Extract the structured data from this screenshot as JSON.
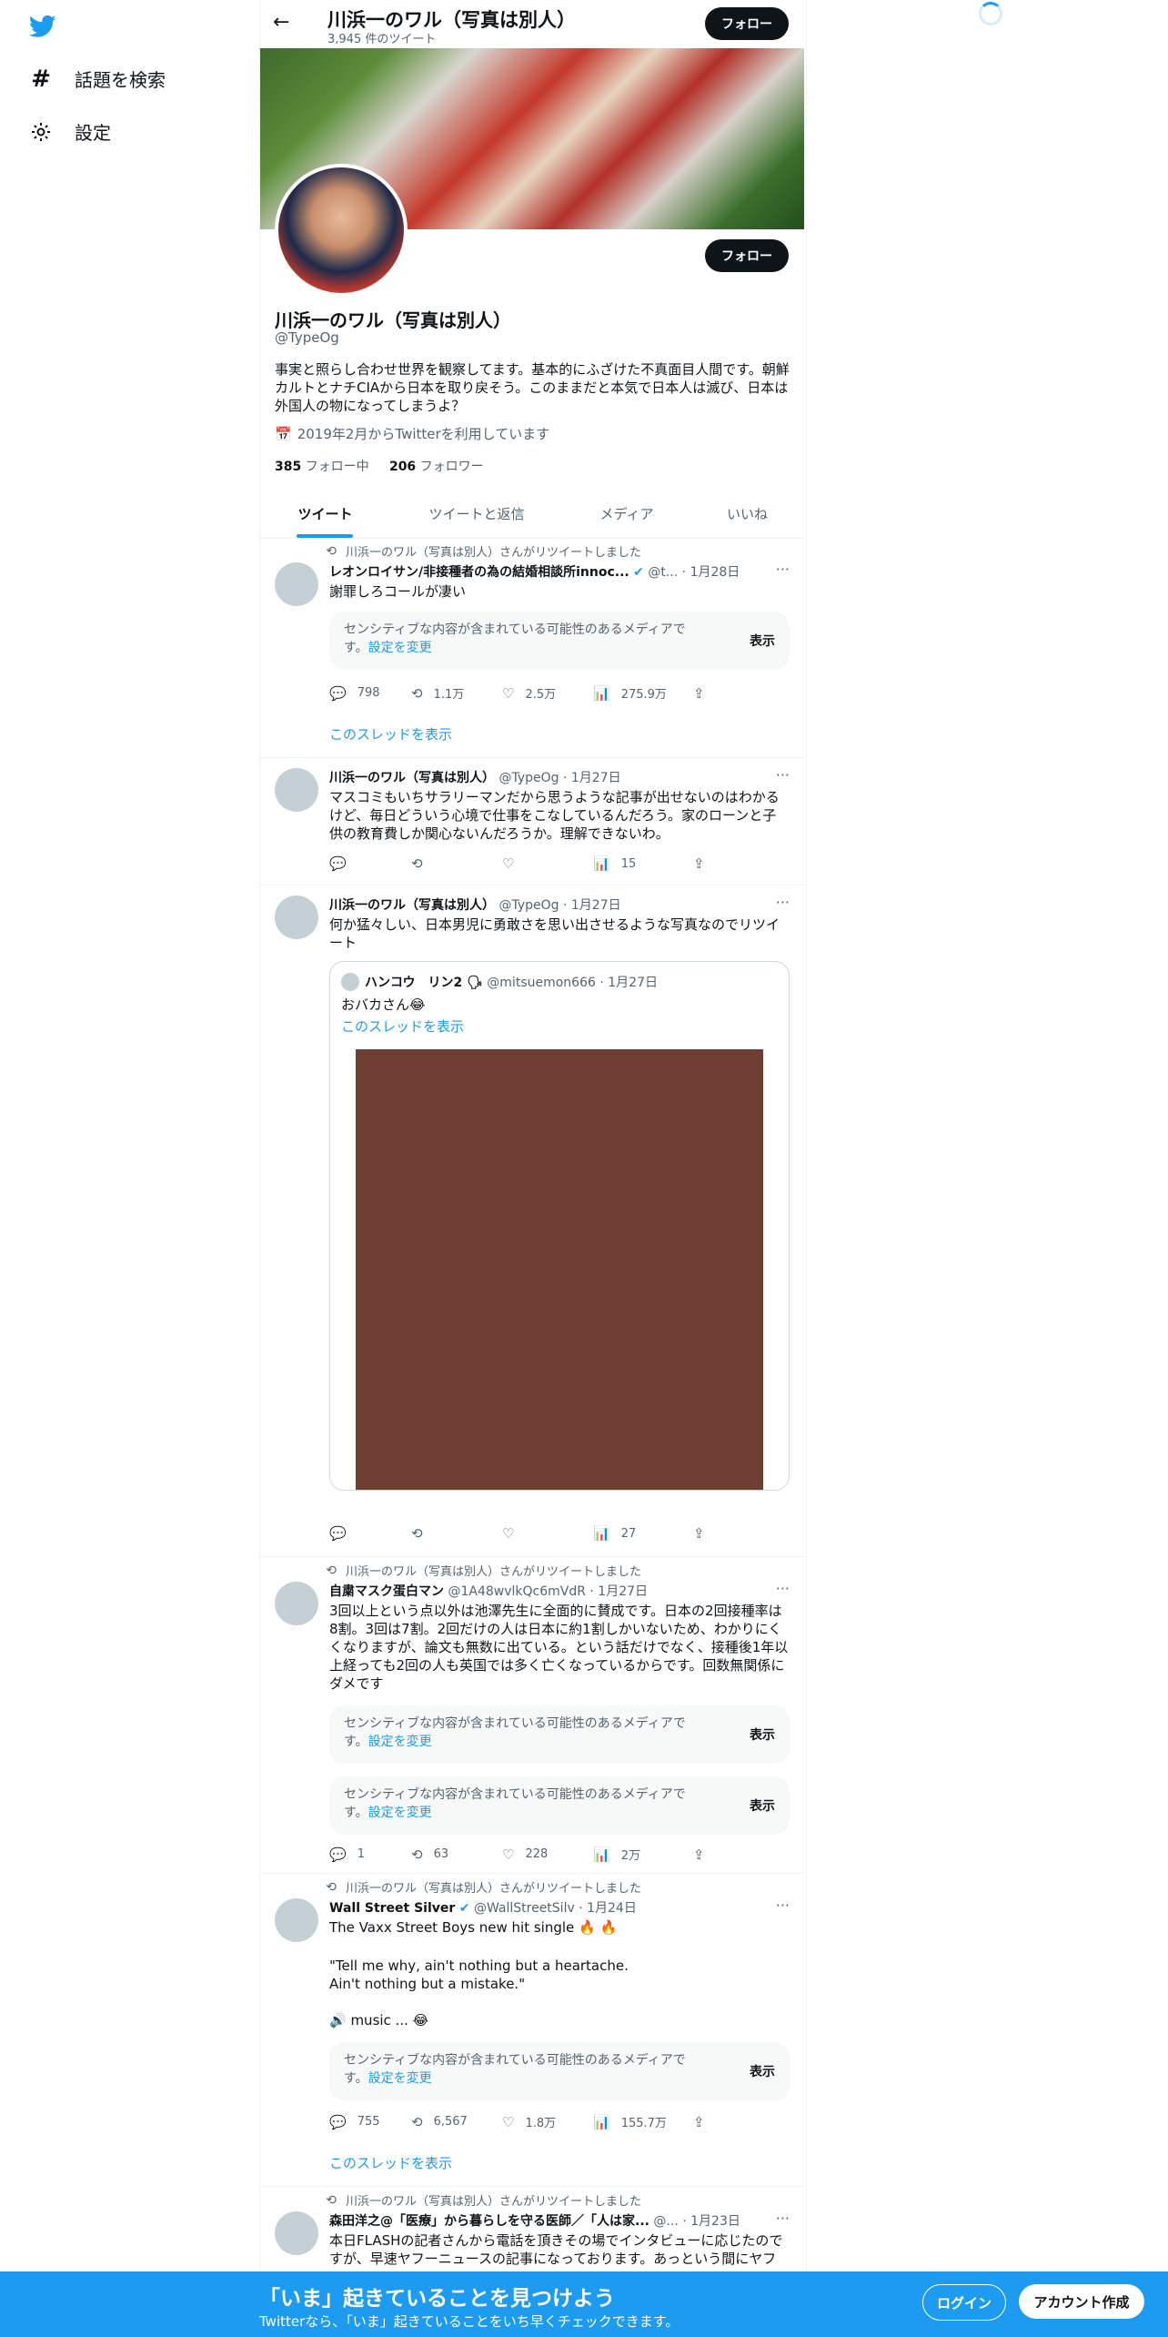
{
  "nav": {
    "items": [
      {
        "icon": "hashtag-icon",
        "label": "話題を検索"
      },
      {
        "icon": "gear-icon",
        "label": "設定"
      }
    ]
  },
  "header": {
    "title": "川浜一のワル（写真は別人）",
    "tweet_count": "3,945 件のツイート",
    "follow_label": "フォロー"
  },
  "profile": {
    "name": "川浜一のワル（写真は別人）",
    "handle": "@TypeOg",
    "bio": "事実と照らし合わせ世界を観察してます。基本的にふざけた不真面目人間です。朝鮮カルトとナチCIAから日本を取り戻そう。このままだと本気で日本人は滅び、日本は外国人の物になってしまうよ？",
    "joined": "2019年2月からTwitterを利用しています",
    "following_count": "385",
    "following_label": "フォロー中",
    "followers_count": "206",
    "followers_label": "フォロワー",
    "follow_label": "フォロー"
  },
  "tabs": [
    "ツイート",
    "ツイートと返信",
    "メディア",
    "いいね"
  ],
  "sensitive": {
    "text": "センシティブな内容が含まれている可能性のあるメディアです。",
    "link": "設定を変更",
    "show": "表示"
  },
  "thread_label": "このスレッドを表示",
  "tweets": [
    {
      "retweet_by": "川浜一のワル（写真は別人）さんがリツイートしました",
      "name": "レオンロイサン/非接種者の為の結婚相談所innoc...",
      "handle": "@t...",
      "date": "1月28日",
      "text": "謝罪しろコールが凄い",
      "stats": {
        "reply": "798",
        "retweet": "1.1万",
        "like": "2.5万",
        "views": "275.9万"
      }
    },
    {
      "name": "川浜一のワル（写真は別人）",
      "handle": "@TypeOg",
      "date": "1月27日",
      "text": "マスコミもいちサラリーマンだから思うような記事が出せないのはわかるけど、毎日どういう心境で仕事をこなしているんだろう。家のローンと子供の教育費しか関心ないんだろうか。理解できないわ。",
      "stats": {
        "views": "15"
      }
    },
    {
      "name": "川浜一のワル（写真は別人）",
      "handle": "@TypeOg",
      "date": "1月27日",
      "text": "何か猛々しい、日本男児に勇敢さを思い出させるような写真なのでリツイート",
      "quote": {
        "name": "ハンコウ　リン2 🗣",
        "handle": "@mitsuemon666",
        "date": "1月27日",
        "text": "おバカさん😂",
        "image_color": "#6e3e33"
      },
      "stats": {
        "views": "27"
      }
    },
    {
      "retweet_by": "川浜一のワル（写真は別人）さんがリツイートしました",
      "name": "自粛マスク蛋白マン",
      "handle": "@1A48wvlkQc6mVdR",
      "date": "1月27日",
      "text": "3回以上という点以外は池澤先生に全面的に賛成です。日本の2回接種率は8割。3回は7割。2回だけの人は日本に約1割しかいないため、わかりにくくなりますが、論文も無数に出ている。という話だけでなく、接種後1年以上経っても2回の人も英国では多く亡くなっているからです。回数無関係にダメです",
      "stats": {
        "reply": "1",
        "retweet": "63",
        "like": "228",
        "views": "2万"
      }
    },
    {
      "retweet_by": "川浜一のワル（写真は別人）さんがリツイートしました",
      "name": "Wall Street Silver",
      "handle": "@WallStreetSilv",
      "date": "1月24日",
      "text1": "The Vaxx Street Boys new hit single 🔥 🔥",
      "text2": "\"Tell me why, ain't nothing but a heartache.",
      "text3": "Ain't nothing but a mistake.\"",
      "text4": "🔊 music ... 😂",
      "stats": {
        "reply": "755",
        "retweet": "6,567",
        "like": "1.8万",
        "views": "155.7万"
      }
    },
    {
      "retweet_by": "川浜一のワル（写真は別人）さんがリツイートしました",
      "name": "森田洋之@「医療」から暮らしを守る医師／「人は家...",
      "handle": "@...",
      "date": "1月23日",
      "text": "本日FLASHの記者さんから電話を頂きその場でインタビューに応じたのですが、早速ヤフーニュースの記事になっております。あっという間にヤフ"
    }
  ],
  "bottom_bar": {
    "title": "「いま」起きていることを見つけよう",
    "subtitle": "Twitterなら、「いま」起きていることをいち早くチェックできます。",
    "login": "ログイン",
    "signup": "アカウント作成"
  }
}
